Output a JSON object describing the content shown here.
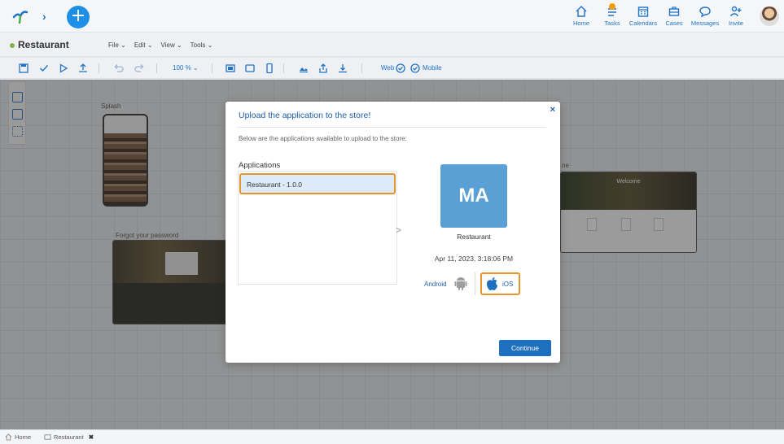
{
  "topbar": {
    "nav": [
      {
        "label": "Home",
        "icon": "home-icon"
      },
      {
        "label": "Tasks",
        "icon": "tasks-icon"
      },
      {
        "label": "Calendars",
        "icon": "calendar-icon"
      },
      {
        "label": "Cases",
        "icon": "cases-icon"
      },
      {
        "label": "Messages",
        "icon": "messages-icon"
      },
      {
        "label": "Invite",
        "icon": "invite-icon"
      }
    ],
    "plus_label": "+"
  },
  "titlebar": {
    "app_title": "Restaurant",
    "menus": [
      "File ⌄",
      "Edit ⌄",
      "View ⌄",
      "Tools ⌄"
    ]
  },
  "toolbar": {
    "zoom": "100 % ⌄",
    "web_label": "Web",
    "mobile_label": "Mobile"
  },
  "canvas": {
    "splash_label": "Splash",
    "forgot_label": "Forgot your password",
    "home_label": "ne",
    "welcome_text": "Welcome"
  },
  "modal": {
    "title": "Upload the application to the store!",
    "close": "×",
    "description": "Below are the applications available to upload to the store:",
    "applications_label": "Applications",
    "selected_app": "Restaurant - 1.0.0",
    "arrow": ">",
    "app_icon_text": "MA",
    "app_name": "Restaurant",
    "app_date": "Apr 11, 2023, 3:18:06 PM",
    "android_label": "Android",
    "ios_label": "iOS",
    "continue_label": "Continue"
  },
  "bottom_tabs": [
    {
      "label": "Home"
    },
    {
      "label": "Restaurant"
    }
  ],
  "colors": {
    "accent": "#1f73c9",
    "highlight": "#e8942a",
    "primary_button": "#1f6fbf",
    "app_icon_bg": "#5aa0d4"
  }
}
